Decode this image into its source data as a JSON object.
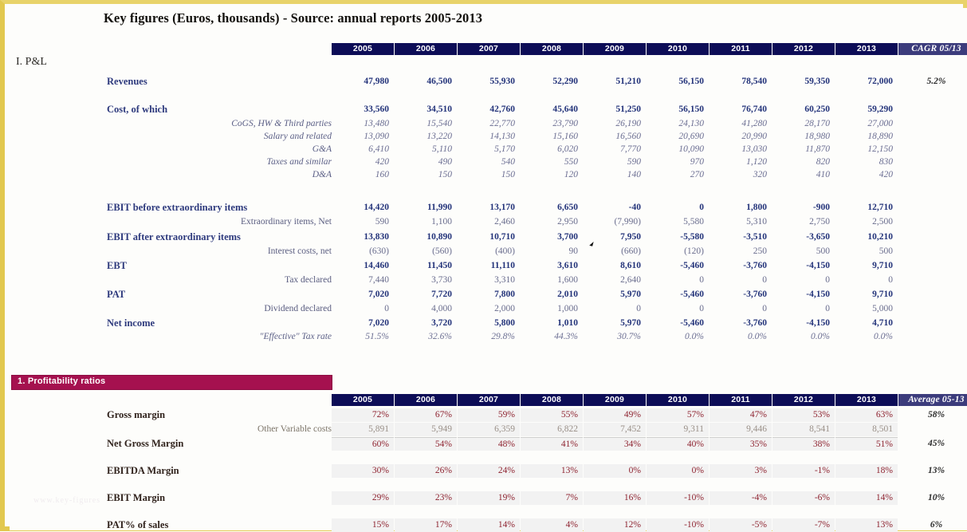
{
  "title": "Key figures (Euros, thousands) - Source: annual reports 2005-2013",
  "watermark": "www.key-figures",
  "sections": {
    "pl_label": "I. P&L",
    "ratios_banner": "1. Profitability ratios"
  },
  "colors": {
    "header_blue": "#0d0d57",
    "cagr_blue": "#3c3c7c",
    "banner_magenta": "#a5114f",
    "frame_gold": "#e2c84f",
    "major_value": "#23337a",
    "ratio_value": "#8e2330"
  },
  "pl_table": {
    "years": [
      "2005",
      "2006",
      "2007",
      "2008",
      "2009",
      "2010",
      "2011",
      "2012",
      "2013"
    ],
    "summary_header": "CAGR 05/13",
    "rows": [
      {
        "label": "Revenues",
        "style": "major",
        "values": [
          "47,980",
          "46,500",
          "55,930",
          "52,290",
          "51,210",
          "56,150",
          "78,540",
          "59,350",
          "72,000"
        ],
        "summary": "5.2%"
      },
      {
        "label": "Cost, of which",
        "style": "major",
        "values": [
          "33,560",
          "34,510",
          "42,760",
          "45,640",
          "51,250",
          "56,150",
          "76,740",
          "60,250",
          "59,290"
        ],
        "summary": ""
      },
      {
        "label": "CoGS, HW & Third parties",
        "style": "sub",
        "values": [
          "13,480",
          "15,540",
          "22,770",
          "23,790",
          "26,190",
          "24,130",
          "41,280",
          "28,170",
          "27,000"
        ],
        "summary": ""
      },
      {
        "label": "Salary and related",
        "style": "sub",
        "values": [
          "13,090",
          "13,220",
          "14,130",
          "15,160",
          "16,560",
          "20,690",
          "20,990",
          "18,980",
          "18,890"
        ],
        "summary": ""
      },
      {
        "label": "G&A",
        "style": "sub",
        "values": [
          "6,410",
          "5,110",
          "5,170",
          "6,020",
          "7,770",
          "10,090",
          "13,030",
          "11,870",
          "12,150"
        ],
        "summary": ""
      },
      {
        "label": "Taxes and similar",
        "style": "sub",
        "values": [
          "420",
          "490",
          "540",
          "550",
          "590",
          "970",
          "1,120",
          "820",
          "830"
        ],
        "summary": ""
      },
      {
        "label": "D&A",
        "style": "sub",
        "values": [
          "160",
          "150",
          "150",
          "120",
          "140",
          "270",
          "320",
          "410",
          "420"
        ],
        "summary": ""
      },
      {
        "label": "EBIT before extraordinary items",
        "style": "major",
        "values": [
          "14,420",
          "11,990",
          "13,170",
          "6,650",
          "-40",
          "0",
          "1,800",
          "-900",
          "12,710"
        ],
        "summary": ""
      },
      {
        "label": "Extraordinary items, Net",
        "style": "sub-plain",
        "values": [
          "590",
          "1,100",
          "2,460",
          "2,950",
          "(7,990)",
          "5,580",
          "5,310",
          "2,750",
          "2,500"
        ],
        "summary": ""
      },
      {
        "label": "EBIT after extraordinary items",
        "style": "major",
        "values": [
          "13,830",
          "10,890",
          "10,710",
          "3,700",
          "7,950",
          "-5,580",
          "-3,510",
          "-3,650",
          "10,210"
        ],
        "summary": ""
      },
      {
        "label": "Interest costs, net",
        "style": "sub-plain",
        "values": [
          "(630)",
          "(560)",
          "(400)",
          "90",
          "(660)",
          "(120)",
          "250",
          "500",
          "500"
        ],
        "summary": ""
      },
      {
        "label": "EBT",
        "style": "major",
        "values": [
          "14,460",
          "11,450",
          "11,110",
          "3,610",
          "8,610",
          "-5,460",
          "-3,760",
          "-4,150",
          "9,710"
        ],
        "summary": ""
      },
      {
        "label": "Tax declared",
        "style": "sub-plain",
        "values": [
          "7,440",
          "3,730",
          "3,310",
          "1,600",
          "2,640",
          "0",
          "0",
          "0",
          "0"
        ],
        "summary": ""
      },
      {
        "label": "PAT",
        "style": "major",
        "values": [
          "7,020",
          "7,720",
          "7,800",
          "2,010",
          "5,970",
          "-5,460",
          "-3,760",
          "-4,150",
          "9,710"
        ],
        "summary": ""
      },
      {
        "label": "Dividend declared",
        "style": "sub-plain",
        "values": [
          "0",
          "4,000",
          "2,000",
          "1,000",
          "0",
          "0",
          "0",
          "0",
          "5,000"
        ],
        "summary": ""
      },
      {
        "label": "Net income",
        "style": "major",
        "values": [
          "7,020",
          "3,720",
          "5,800",
          "1,010",
          "5,970",
          "-5,460",
          "-3,760",
          "-4,150",
          "4,710"
        ],
        "summary": ""
      },
      {
        "label": "\"Effective\" Tax rate",
        "style": "sub",
        "values": [
          "51.5%",
          "32.6%",
          "29.8%",
          "44.3%",
          "30.7%",
          "0.0%",
          "0.0%",
          "0.0%",
          "0.0%"
        ],
        "summary": ""
      }
    ]
  },
  "ratios_table": {
    "years": [
      "2005",
      "2006",
      "2007",
      "2008",
      "2009",
      "2010",
      "2011",
      "2012",
      "2013"
    ],
    "summary_header": "Average 05-13",
    "rows": [
      {
        "label": "Gross margin",
        "style": "ratio",
        "values": [
          "72%",
          "67%",
          "59%",
          "55%",
          "49%",
          "57%",
          "47%",
          "53%",
          "63%"
        ],
        "summary": "58%"
      },
      {
        "label": "Other Variable costs",
        "style": "ratio-sub",
        "values": [
          "5,891",
          "5,949",
          "6,359",
          "6,822",
          "7,452",
          "9,311",
          "9,446",
          "8,541",
          "8,501"
        ],
        "summary": ""
      },
      {
        "label": "Net Gross Margin",
        "style": "ratio",
        "values": [
          "60%",
          "54%",
          "48%",
          "41%",
          "34%",
          "40%",
          "35%",
          "38%",
          "51%"
        ],
        "summary": "45%"
      },
      {
        "label": "EBITDA Margin",
        "style": "ratio",
        "values": [
          "30%",
          "26%",
          "24%",
          "13%",
          "0%",
          "0%",
          "3%",
          "-1%",
          "18%"
        ],
        "summary": "13%"
      },
      {
        "label": "EBIT Margin",
        "style": "ratio",
        "values": [
          "29%",
          "23%",
          "19%",
          "7%",
          "16%",
          "-10%",
          "-4%",
          "-6%",
          "14%"
        ],
        "summary": "10%"
      },
      {
        "label": "PAT% of sales",
        "style": "ratio",
        "values": [
          "15%",
          "17%",
          "14%",
          "4%",
          "12%",
          "-10%",
          "-5%",
          "-7%",
          "13%"
        ],
        "summary": "6%"
      }
    ]
  }
}
